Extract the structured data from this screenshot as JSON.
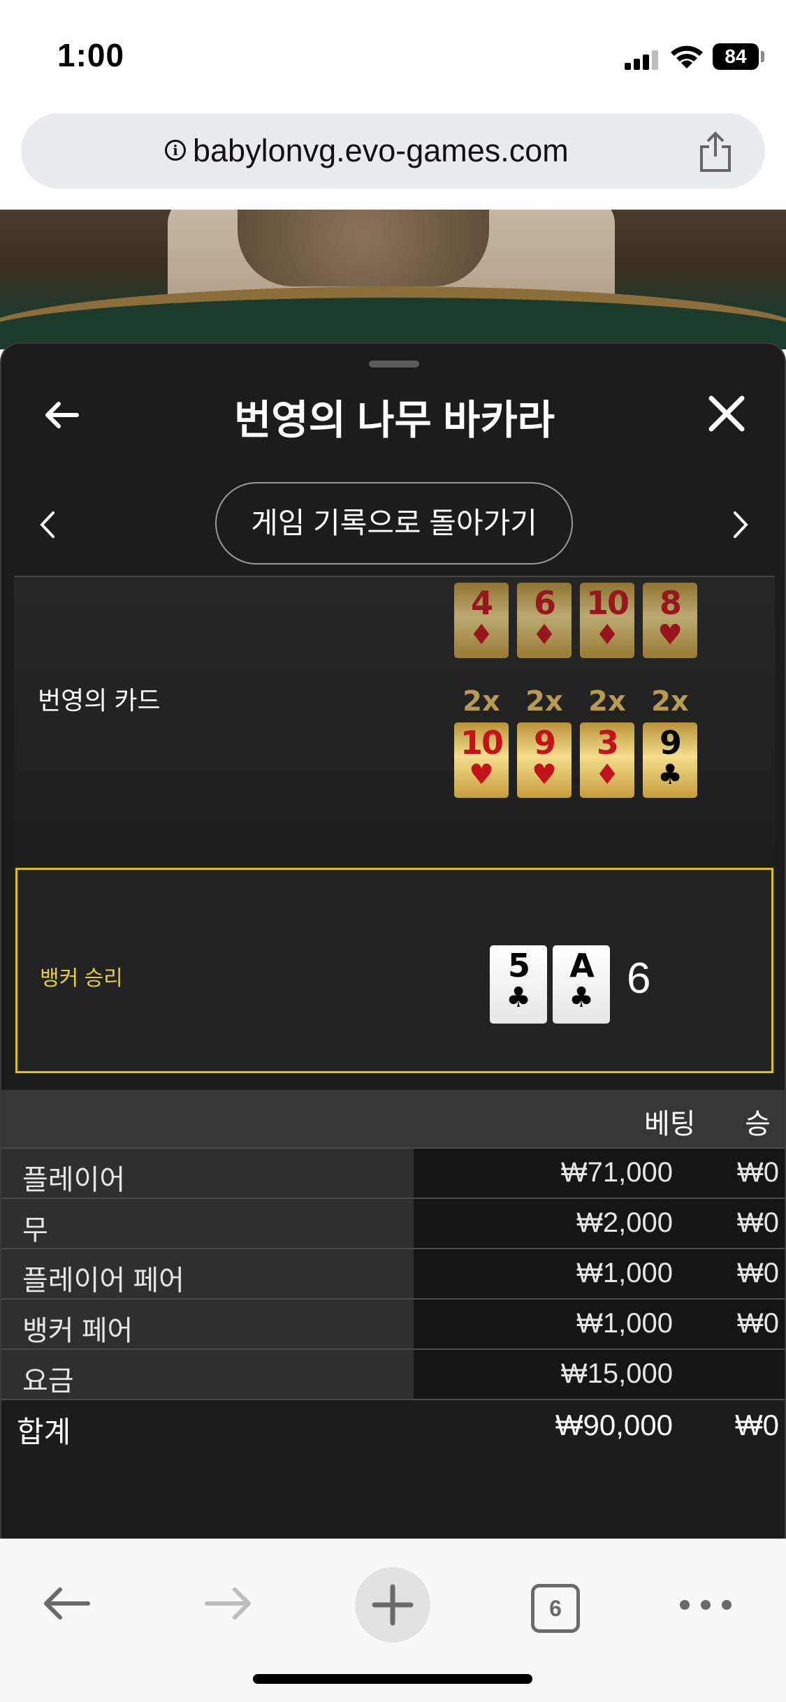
{
  "status_bar": {
    "time": "1:00",
    "battery": "84"
  },
  "browser": {
    "url": "babylonvg.evo-games.com",
    "info_glyph": "i",
    "tab_count": "6"
  },
  "panel": {
    "title": "번영의 나무 바카라",
    "return_button": "게임 기록으로 돌아가기",
    "fortune_label": "번영의 카드",
    "fortune_cards_top": [
      {
        "rank": "4",
        "suit": "♦",
        "color": "red"
      },
      {
        "rank": "6",
        "suit": "♦",
        "color": "red"
      },
      {
        "rank": "10",
        "suit": "♦",
        "color": "red"
      },
      {
        "rank": "8",
        "suit": "♥",
        "color": "red"
      }
    ],
    "multipliers": [
      "2x",
      "2x",
      "2x",
      "2x"
    ],
    "fortune_cards_bottom": [
      {
        "rank": "10",
        "suit": "♥",
        "color": "red"
      },
      {
        "rank": "9",
        "suit": "♥",
        "color": "red"
      },
      {
        "rank": "3",
        "suit": "♦",
        "color": "red"
      },
      {
        "rank": "9",
        "suit": "♣",
        "color": "black"
      }
    ],
    "result": {
      "label": "뱅커 승리",
      "cards": [
        {
          "rank": "5",
          "suit": "♣"
        },
        {
          "rank": "A",
          "suit": "♣"
        }
      ],
      "total": "6"
    },
    "bets": {
      "header_bet": "베팅",
      "header_win": "승",
      "rows": [
        {
          "name": "플레이어",
          "amount": "₩71,000",
          "win": "₩0"
        },
        {
          "name": "무",
          "amount": "₩2,000",
          "win": "₩0"
        },
        {
          "name": "플레이어 페어",
          "amount": "₩1,000",
          "win": "₩0"
        },
        {
          "name": "뱅커 페어",
          "amount": "₩1,000",
          "win": "₩0"
        },
        {
          "name": "요금",
          "amount": "₩15,000",
          "win": ""
        }
      ],
      "total": {
        "name": "합계",
        "amount": "₩90,000",
        "win": "₩0"
      }
    }
  },
  "colors": {
    "panel_bg": "#1c1c1c",
    "gold_card": "#f4dd8c",
    "banker_win": "#e8d21e",
    "card_red": "#c4121a"
  }
}
